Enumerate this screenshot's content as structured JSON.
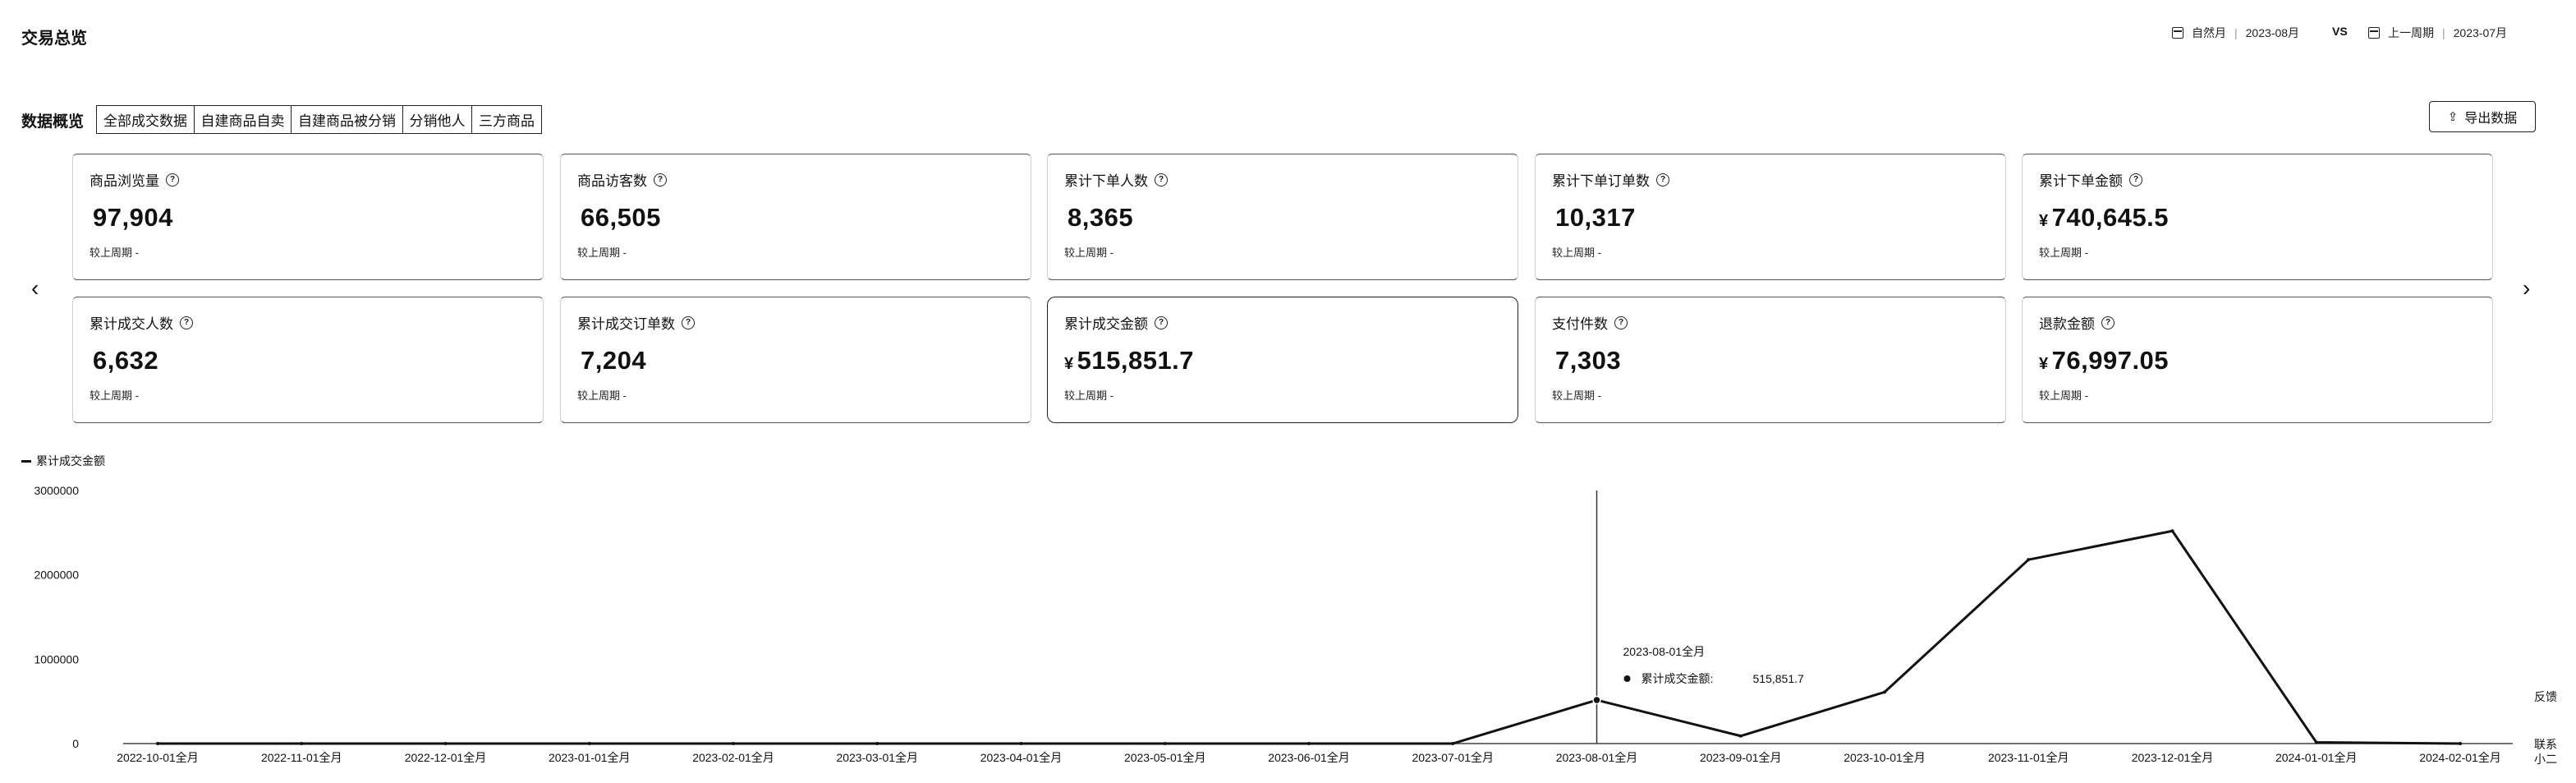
{
  "header": {
    "title": "交易总览",
    "current_period_type": "自然月",
    "current_period_value": "2023-08月",
    "vs": "VS",
    "compare_period_type": "上一周期",
    "compare_period_value": "2023-07月"
  },
  "overview": {
    "title": "数据概览",
    "tabs": [
      "全部成交数据",
      "自建商品自卖",
      "自建商品被分销",
      "分销他人",
      "三方商品"
    ],
    "export_label": "导出数据"
  },
  "metrics": [
    {
      "label": "商品浏览量",
      "currency": "",
      "value": "97,904",
      "compare": "较上周期 -"
    },
    {
      "label": "商品访客数",
      "currency": "",
      "value": "66,505",
      "compare": "较上周期 -"
    },
    {
      "label": "累计下单人数",
      "currency": "",
      "value": "8,365",
      "compare": "较上周期 -"
    },
    {
      "label": "累计下单订单数",
      "currency": "",
      "value": "10,317",
      "compare": "较上周期 -"
    },
    {
      "label": "累计下单金额",
      "currency": "¥",
      "value": "740,645.5",
      "compare": "较上周期 -"
    },
    {
      "label": "累计成交人数",
      "currency": "",
      "value": "6,632",
      "compare": "较上周期 -"
    },
    {
      "label": "累计成交订单数",
      "currency": "",
      "value": "7,204",
      "compare": "较上周期 -"
    },
    {
      "label": "累计成交金额",
      "currency": "¥",
      "value": "515,851.7",
      "compare": "较上周期 -"
    },
    {
      "label": "支付件数",
      "currency": "",
      "value": "7,303",
      "compare": "较上周期 -"
    },
    {
      "label": "退款金额",
      "currency": "¥",
      "value": "76,997.05",
      "compare": "较上周期 -"
    }
  ],
  "side_buttons": {
    "feedback": "反馈",
    "contact": "联系",
    "assistant": "小二"
  },
  "chart_data": {
    "type": "line",
    "legend": "累计成交金额",
    "categories": [
      "2022-10-01全月",
      "2022-11-01全月",
      "2022-12-01全月",
      "2023-01-01全月",
      "2023-02-01全月",
      "2023-03-01全月",
      "2023-04-01全月",
      "2023-05-01全月",
      "2023-06-01全月",
      "2023-07-01全月",
      "2023-08-01全月",
      "2023-09-01全月",
      "2023-10-01全月",
      "2023-11-01全月",
      "2023-12-01全月",
      "2024-01-01全月",
      "2024-02-01全月"
    ],
    "series": [
      {
        "name": "累计成交金额",
        "values": [
          0,
          0,
          0,
          0,
          0,
          0,
          0,
          0,
          0,
          0,
          515851.7,
          90000,
          610000,
          2180000,
          2520000,
          15000,
          0
        ]
      }
    ],
    "yticks": [
      0,
      1000000,
      2000000,
      3000000
    ],
    "ylim": [
      0,
      3000000
    ],
    "tooltip": {
      "title": "2023-08-01全月",
      "label": "累计成交金额:",
      "value": "515,851.7",
      "index": 10
    }
  }
}
